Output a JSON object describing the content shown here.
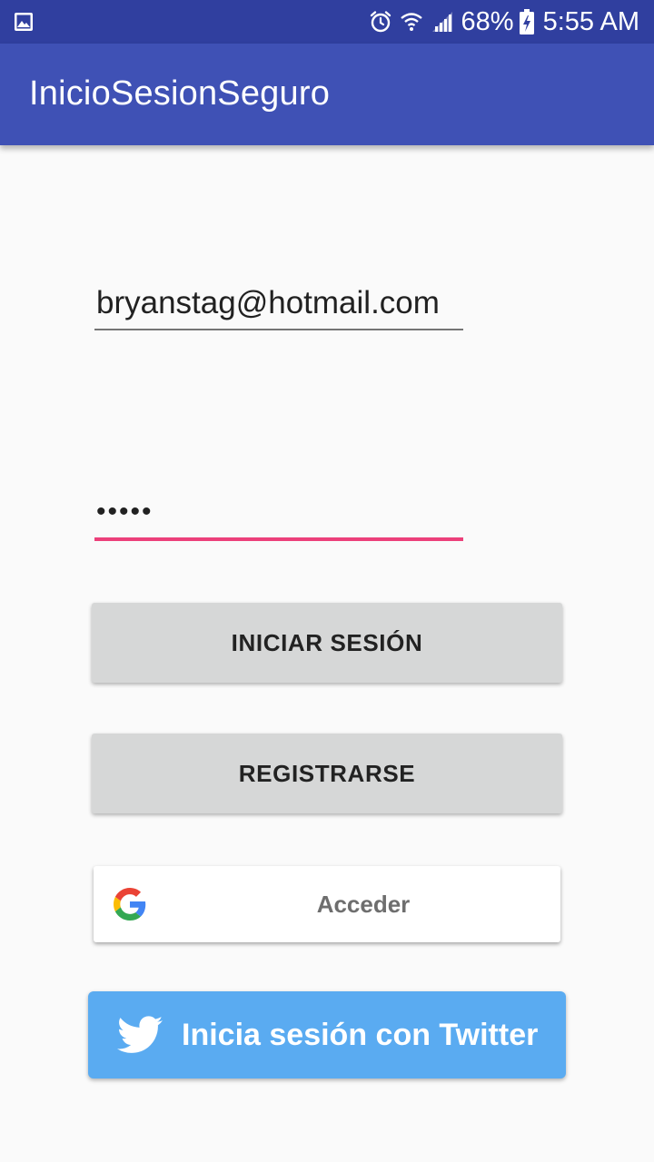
{
  "status_bar": {
    "battery_percent": "68%",
    "time": "5:55 AM",
    "icons": [
      "gallery-icon",
      "alarm-icon",
      "wifi-icon",
      "signal-icon",
      "battery-charging-icon"
    ]
  },
  "app_bar": {
    "title": "InicioSesionSeguro"
  },
  "form": {
    "email_value": "bryanstag@hotmail.com",
    "password_value": "•••••"
  },
  "buttons": {
    "login_label": "INICIAR SESIÓN",
    "register_label": "REGISTRARSE",
    "google_label": "Acceder",
    "twitter_label": "Inicia sesión con Twitter"
  },
  "colors": {
    "status_bar": "#303f9f",
    "app_bar": "#3f51b5",
    "accent": "#ec407a",
    "button_gray": "#d6d7d7",
    "twitter_blue": "#5aabf1"
  }
}
